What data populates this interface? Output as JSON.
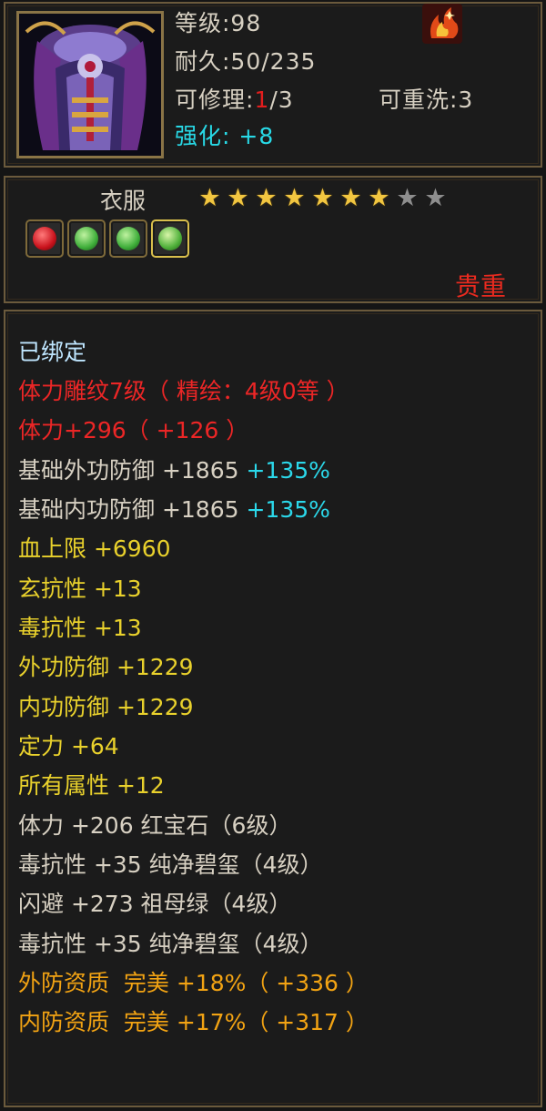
{
  "header": {
    "level": "等级:98",
    "durability": "耐久:50/235",
    "repairable_label": "可修理:",
    "repairable_used": "1",
    "repairable_total": "/3",
    "rewashable": "可重洗:3",
    "enhance_label": "强化:",
    "enhance_value": "+8"
  },
  "item": {
    "slot": "衣服",
    "stars_total": 9,
    "stars_filled": 7,
    "rarity": "贵重",
    "gem_sockets": [
      {
        "color": "#d4202a",
        "name": "red-gem-icon"
      },
      {
        "color": "#3fae3a",
        "name": "green-gem-icon"
      },
      {
        "color": "#3fae3a",
        "name": "green-gem-icon"
      },
      {
        "color": "#4fb03a",
        "name": "green-gem-icon"
      }
    ]
  },
  "attributes": {
    "bound": "已绑定",
    "engrave": "体力雕纹7级（ 精绘：4级0等 ）",
    "stamina_engrave": "体力+296（ +126 ）",
    "base_outer_def": "基础外功防御 +1865",
    "base_outer_def_pct": "+135%",
    "base_inner_def": "基础内功防御 +1865",
    "base_inner_def_pct": "+135%",
    "hp_max": "血上限 +6960",
    "xuan_res": "玄抗性 +13",
    "poison_res": "毒抗性 +13",
    "outer_def": "外功防御 +1229",
    "inner_def": "内功防御 +1229",
    "focus": "定力 +64",
    "all_attrs": "所有属性 +12",
    "gem1": "体力 +206 红宝石（6级）",
    "gem2": "毒抗性 +35 纯净碧玺（4级）",
    "gem3": "闪避 +273 祖母绿（4级）",
    "gem4": "毒抗性 +35 纯净碧玺（4级）",
    "outer_quality": "外防资质  完美 +18%（ +336 ）",
    "inner_quality": "内防资质  完美 +17%（ +317 ）"
  },
  "colors": {
    "border": "#6b5a3c",
    "yellow": "#e9d12c",
    "cyan": "#2bd8ea",
    "red": "#ec2626",
    "orange": "#f2a313"
  }
}
